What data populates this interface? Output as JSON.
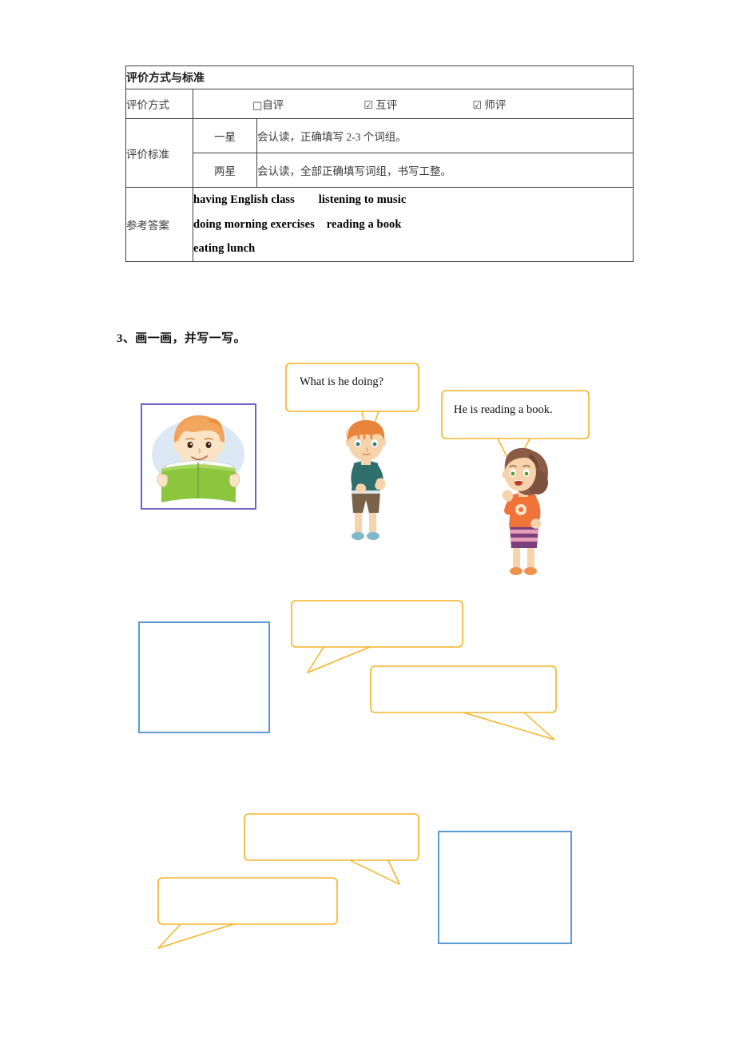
{
  "document": {
    "title": "评价方式与标准"
  },
  "eval_table": {
    "header": "评价方式与标准",
    "method_row": {
      "label": "评价方式",
      "options": [
        {
          "checkbox": "□",
          "label": "自评",
          "checked": false
        },
        {
          "checkbox": "☑",
          "label": "互评",
          "checked": true
        },
        {
          "checkbox": "☑",
          "label": "师评",
          "checked": true
        }
      ]
    },
    "criteria_row": {
      "label": "评价标准",
      "items": [
        {
          "star": "一星",
          "text": "会认读，正确填写 2-3 个词组。"
        },
        {
          "star": "两星",
          "text": "会认读，全部正确填写词组，书写工整。"
        }
      ]
    },
    "answer_row": {
      "label": "参考答案",
      "lines": [
        "having English class        listening to music",
        "doing morning exercises    reading a book",
        "eating lunch"
      ]
    }
  },
  "exercise": {
    "heading": "3、画一画，并写一写。",
    "example": {
      "picture_alt": "boy reading a green book",
      "question_bubble": "What is he doing?",
      "answer_bubble": "He is reading a book."
    },
    "blank_rows": [
      {
        "box_position": "left",
        "bubbles": [
          "",
          ""
        ]
      },
      {
        "box_position": "right",
        "bubbles": [
          "",
          ""
        ]
      }
    ]
  },
  "colors": {
    "bubble_stroke": "#F5B324",
    "box_border": "#5B9BD5",
    "picture_frame": "#6E62C8",
    "table_border": "#404040",
    "boy_hair": "#E8853C",
    "boy_shirt": "#2F6F6B",
    "boy_shorts": "#7A6248",
    "girl_hair": "#8A5B45",
    "girl_shirt": "#F0733A",
    "girl_skirt": "#7B3F7E",
    "book_green": "#7DBF4E",
    "skin": "#F8CFA4"
  }
}
